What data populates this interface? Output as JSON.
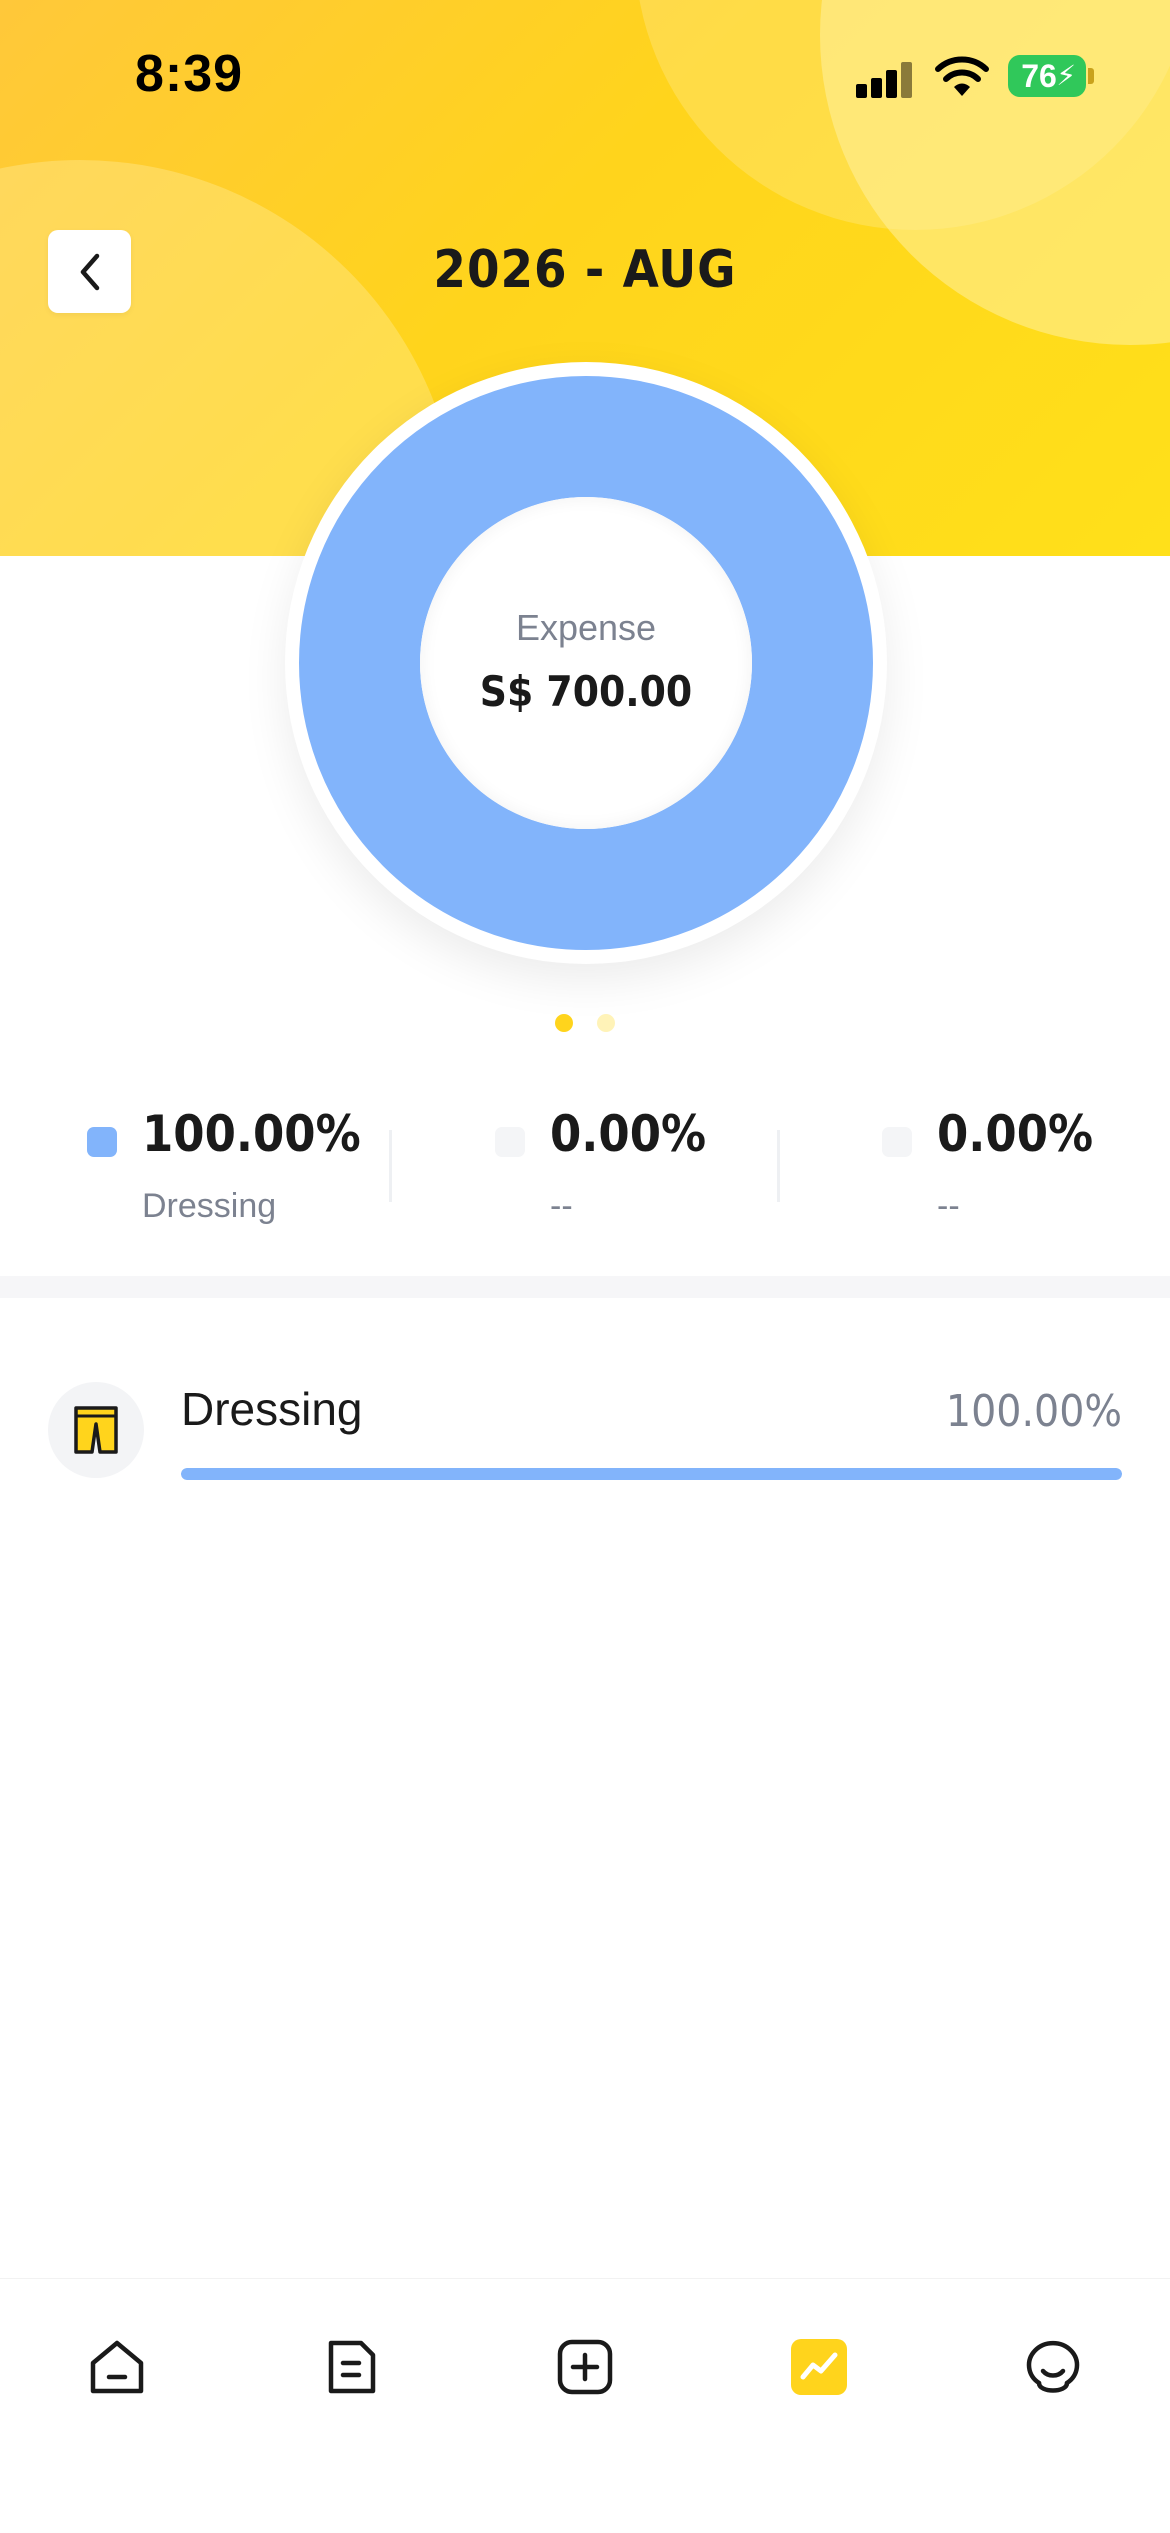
{
  "status_bar": {
    "time": "8:39",
    "battery": "76"
  },
  "header": {
    "title": "2026 - AUG"
  },
  "summary": {
    "label": "Expense",
    "amount": "S$ 700.00"
  },
  "chart_data": {
    "type": "pie",
    "series": [
      {
        "name": "Dressing",
        "value": 100.0,
        "color": "#82B4FB"
      }
    ],
    "center_label": "Expense",
    "center_value": "S$ 700.00"
  },
  "pager": {
    "pages": 2,
    "active": 0,
    "active_color": "#FFD41C",
    "inactive_color": "#FFF3B8"
  },
  "legend": [
    {
      "percent": "100.00%",
      "name": "Dressing",
      "color": "#82B4FB"
    },
    {
      "percent": "0.00%",
      "name": "--",
      "color": "#F4F5F7"
    },
    {
      "percent": "0.00%",
      "name": "--",
      "color": "#F4F5F7"
    }
  ],
  "categories": [
    {
      "name": "Dressing",
      "percent": "100.00%",
      "fraction": 1.0,
      "icon": "shorts-icon",
      "color": "#82B4FB"
    }
  ],
  "tabbar": {
    "items": [
      {
        "icon": "home-icon",
        "active": false
      },
      {
        "icon": "bill-list-icon",
        "active": false
      },
      {
        "icon": "add-record-icon",
        "active": false
      },
      {
        "icon": "chart-icon",
        "active": true
      },
      {
        "icon": "profile-icon",
        "active": false
      }
    ],
    "accent": "#FFD41C"
  }
}
